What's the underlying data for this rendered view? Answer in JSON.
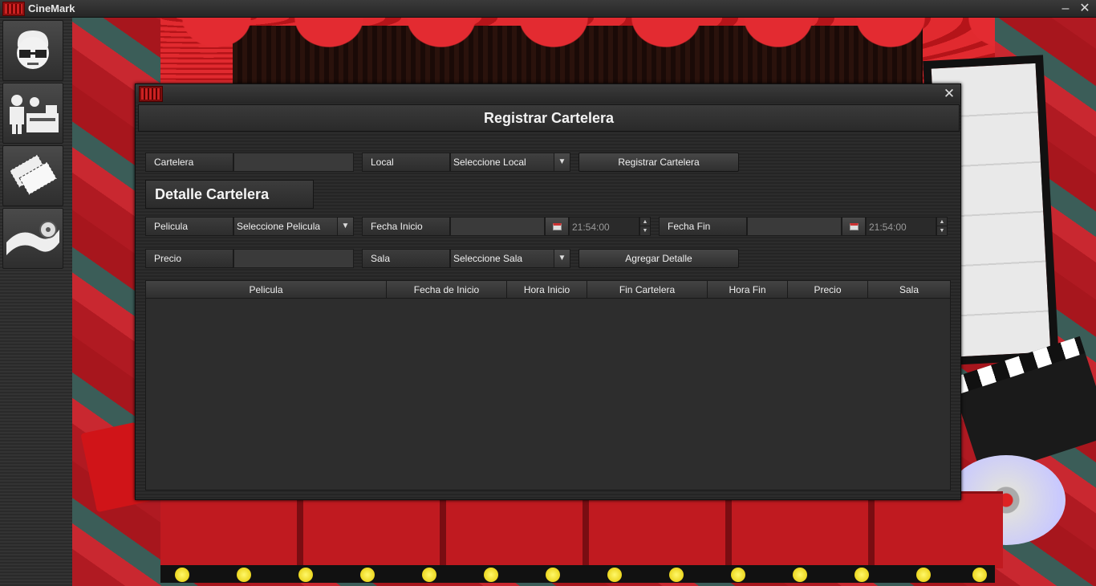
{
  "app": {
    "title": "CineMark"
  },
  "window_controls": {
    "minimize": "–",
    "close": "✕"
  },
  "sidebar": {
    "items": [
      {
        "icon": "user-glasses-icon"
      },
      {
        "icon": "cashier-desk-icon"
      },
      {
        "icon": "tickets-icon"
      },
      {
        "icon": "film-reel-icon"
      }
    ]
  },
  "dialog": {
    "close": "✕",
    "header": "Registrar Cartelera",
    "cartelera_label": "Cartelera",
    "cartelera_value": "",
    "local_label": "Local",
    "local_select": "Seleccione Local",
    "register_button": "Registrar Cartelera",
    "detail_title": "Detalle Cartelera",
    "pelicula_label": "Pelicula",
    "pelicula_select": "Seleccione Pelicula",
    "fecha_inicio_label": "Fecha Inicio",
    "fecha_inicio_value": "",
    "hora_inicio": "21:54:00",
    "fecha_fin_label": "Fecha Fin",
    "fecha_fin_value": "",
    "hora_fin": "21:54:00",
    "precio_label": "Precio",
    "precio_value": "",
    "sala_label": "Sala",
    "sala_select": "Seleccione Sala",
    "add_detail_button": "Agregar Detalle",
    "table": {
      "columns": [
        "Pelicula",
        "Fecha de Inicio",
        "Hora Inicio",
        "Fin Cartelera",
        "Hora Fin",
        "Precio",
        "Sala"
      ],
      "rows": []
    }
  }
}
